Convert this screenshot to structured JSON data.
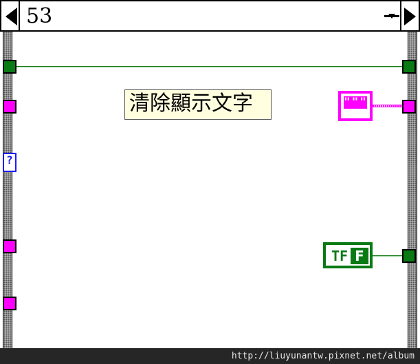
{
  "case_selector": {
    "value": "53"
  },
  "comment": {
    "text": "清除顯示文字"
  },
  "string_constant": {
    "glyph": "\"\"\""
  },
  "boolean_constant": {
    "tf_glyph": "TF",
    "value_label": "F"
  },
  "tunnels": {
    "unknown_glyph": "?"
  },
  "footer": {
    "url": "http://liuyunantw.pixnet.net/album"
  },
  "colors": {
    "boolean": "#0a7a14",
    "string": "#ff00ff",
    "unknown": "#1a1aff",
    "frame": "#b8b8b8",
    "comment_bg": "#ffffe0"
  }
}
